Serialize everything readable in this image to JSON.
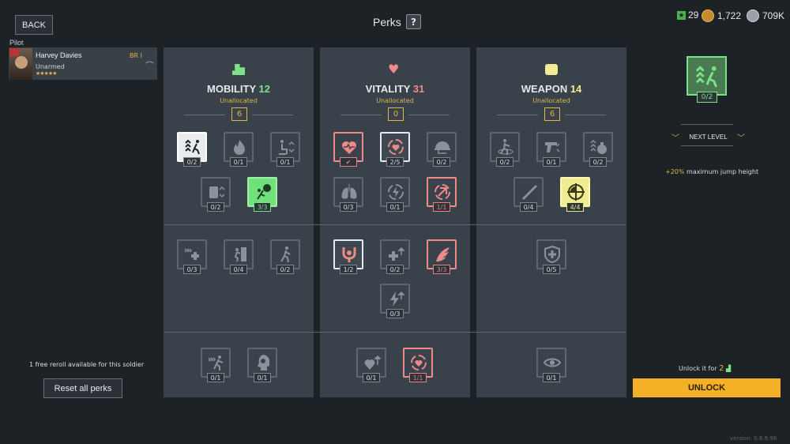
{
  "header": {
    "back_label": "BACK",
    "title": "Perks",
    "help_label": "?"
  },
  "currency": {
    "stars": "29",
    "gold": "1,722",
    "silver": "709K",
    "star_color": "#4caf50",
    "gold_color": "#c98a2a",
    "silver_color": "#9aa0a6"
  },
  "pilot": {
    "label": "Pilot",
    "name": "Harvey Davies",
    "br": "BR I",
    "weapon": "Unarmed",
    "stars": "★★★★★"
  },
  "reroll": {
    "text": "1 free reroll available for this soldier",
    "reset_label": "Reset all perks"
  },
  "categories": [
    {
      "name": "MOBILITY",
      "points": "12",
      "unallocated": "Unallocated",
      "value": "6",
      "points_color": "#7fe08a"
    },
    {
      "name": "VITALITY",
      "points": "31",
      "unallocated": "Unallocated",
      "value": "0",
      "points_color": "#f08a8a"
    },
    {
      "name": "WEAPON",
      "points": "14",
      "unallocated": "Unallocated",
      "value": "6",
      "points_color": "#f1ec91"
    }
  ],
  "perks": {
    "mobility": [
      "0/2",
      "0/1",
      "0/1",
      "0/2",
      "3/3",
      "0/3",
      "0/4",
      "0/2",
      "0/1",
      "0/1"
    ],
    "vitality": [
      "✔",
      "2/5",
      "0/2",
      "0/3",
      "0/1",
      "1/1",
      "1/2",
      "0/2",
      "3/3",
      "0/3",
      "0/1",
      "1/1"
    ],
    "weapon": [
      "0/2",
      "0/1",
      "0/2",
      "0/4",
      "4/4",
      "0/5",
      "0/1"
    ]
  },
  "detail": {
    "count": "0/2",
    "next_level": "NEXT LEVEL",
    "bonus_value": "+20%",
    "bonus_text": "maximum jump height",
    "unlock_for": "Unlock it for",
    "cost": "2",
    "unlock_label": "UNLOCK"
  },
  "version": "version: 0.6.9.98"
}
